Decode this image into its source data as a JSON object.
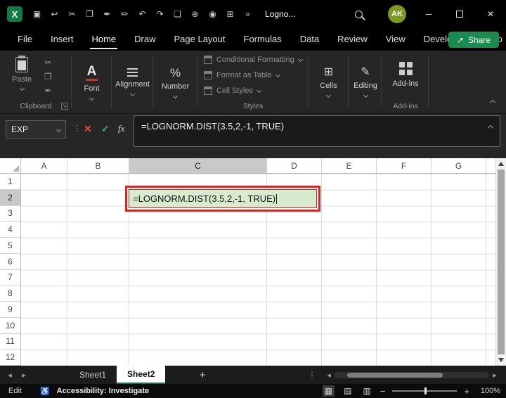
{
  "titlebar": {
    "logo_glyph": "X",
    "title": "Logno...",
    "avatar_initials": "AK",
    "minimize_glyph": "─",
    "close_glyph": "✕",
    "qat_icons": [
      {
        "name": "save-icon",
        "glyph": "▣"
      },
      {
        "name": "undo-icon",
        "glyph": "↩"
      },
      {
        "name": "cut-icon",
        "glyph": "✂"
      },
      {
        "name": "copy-icon",
        "glyph": "❐"
      },
      {
        "name": "format-painter-icon",
        "glyph": "✒"
      },
      {
        "name": "draw-icon",
        "glyph": "✏"
      },
      {
        "name": "undo-arrow-icon",
        "glyph": "↶"
      },
      {
        "name": "redo-arrow-icon",
        "glyph": "↷"
      },
      {
        "name": "document-icon",
        "glyph": "❏"
      },
      {
        "name": "attach-icon",
        "glyph": "⊕"
      },
      {
        "name": "camera-icon",
        "glyph": "◉"
      },
      {
        "name": "table-icon",
        "glyph": "⊞"
      },
      {
        "name": "more-commands-icon",
        "glyph": "»"
      }
    ]
  },
  "menubar": {
    "tabs": [
      "File",
      "Insert",
      "Home",
      "Draw",
      "Page Layout",
      "Formulas",
      "Data",
      "Review",
      "View",
      "Developer",
      "Help"
    ],
    "active_tab": "Home",
    "share_label": "Share",
    "share_icon_glyph": "↗"
  },
  "ribbon": {
    "paste": {
      "label": "Paste"
    },
    "clipboard": {
      "label": "Clipboard",
      "launcher_glyph": "↘",
      "icons": [
        {
          "name": "cut-icon",
          "glyph": "✂"
        },
        {
          "name": "copy-icon",
          "glyph": "❐"
        },
        {
          "name": "format-painter-icon",
          "glyph": "✒"
        }
      ]
    },
    "font": {
      "label": "Font",
      "glyph": "A"
    },
    "alignment": {
      "label": "Alignment"
    },
    "number": {
      "label": "Number",
      "glyph": "%"
    },
    "styles": {
      "label": "Styles",
      "items": [
        "Conditional Formatting",
        "Format as Table",
        "Cell Styles"
      ]
    },
    "cells": {
      "label": "Cells",
      "glyph": "⊞"
    },
    "editing": {
      "label": "Editing",
      "glyph": "✎"
    },
    "addins": {
      "label": "Add-ins",
      "button_label": "Add-ins"
    }
  },
  "formula_bar": {
    "name_box": "EXP",
    "grip_glyph": "⋮",
    "cancel_glyph": "✕",
    "enter_glyph": "✓",
    "fx_label": "fx",
    "formula": "=LOGNORM.DIST(3.5,2,-1, TRUE)"
  },
  "grid": {
    "columns": [
      "A",
      "B",
      "C",
      "D",
      "E",
      "F",
      "G"
    ],
    "rows": [
      "1",
      "2",
      "3",
      "4",
      "5",
      "6",
      "7",
      "8",
      "9",
      "10",
      "11",
      "12"
    ],
    "selected_column": "C",
    "selected_row": "2",
    "active_cell_value": "=LOGNORM.DIST(3.5,2,-1, TRUE)"
  },
  "sheet_bar": {
    "nav_left_glyph": "◂",
    "nav_right_glyph": "▸",
    "tabs": [
      "Sheet1",
      "Sheet2"
    ],
    "active_tab": "Sheet2",
    "add_label": "+",
    "more_glyph": "⋮"
  },
  "status_bar": {
    "mode": "Edit",
    "accessibility_icon_glyph": "♿",
    "accessibility": "Accessibility: Investigate",
    "view_icons": [
      {
        "name": "normal-view-icon",
        "glyph": "▦"
      },
      {
        "name": "page-layout-view-icon",
        "glyph": "▤"
      },
      {
        "name": "page-break-view-icon",
        "glyph": "▥"
      }
    ],
    "zoom_out_glyph": "−",
    "zoom_in_glyph": "+",
    "zoom": "100%"
  },
  "colors": {
    "excel_green": "#107C41",
    "share_green": "#1a8a4e",
    "annotation_red": "#e42320",
    "active_cell_fill": "#d8ebcf",
    "avatar_green": "#7a9a23"
  }
}
